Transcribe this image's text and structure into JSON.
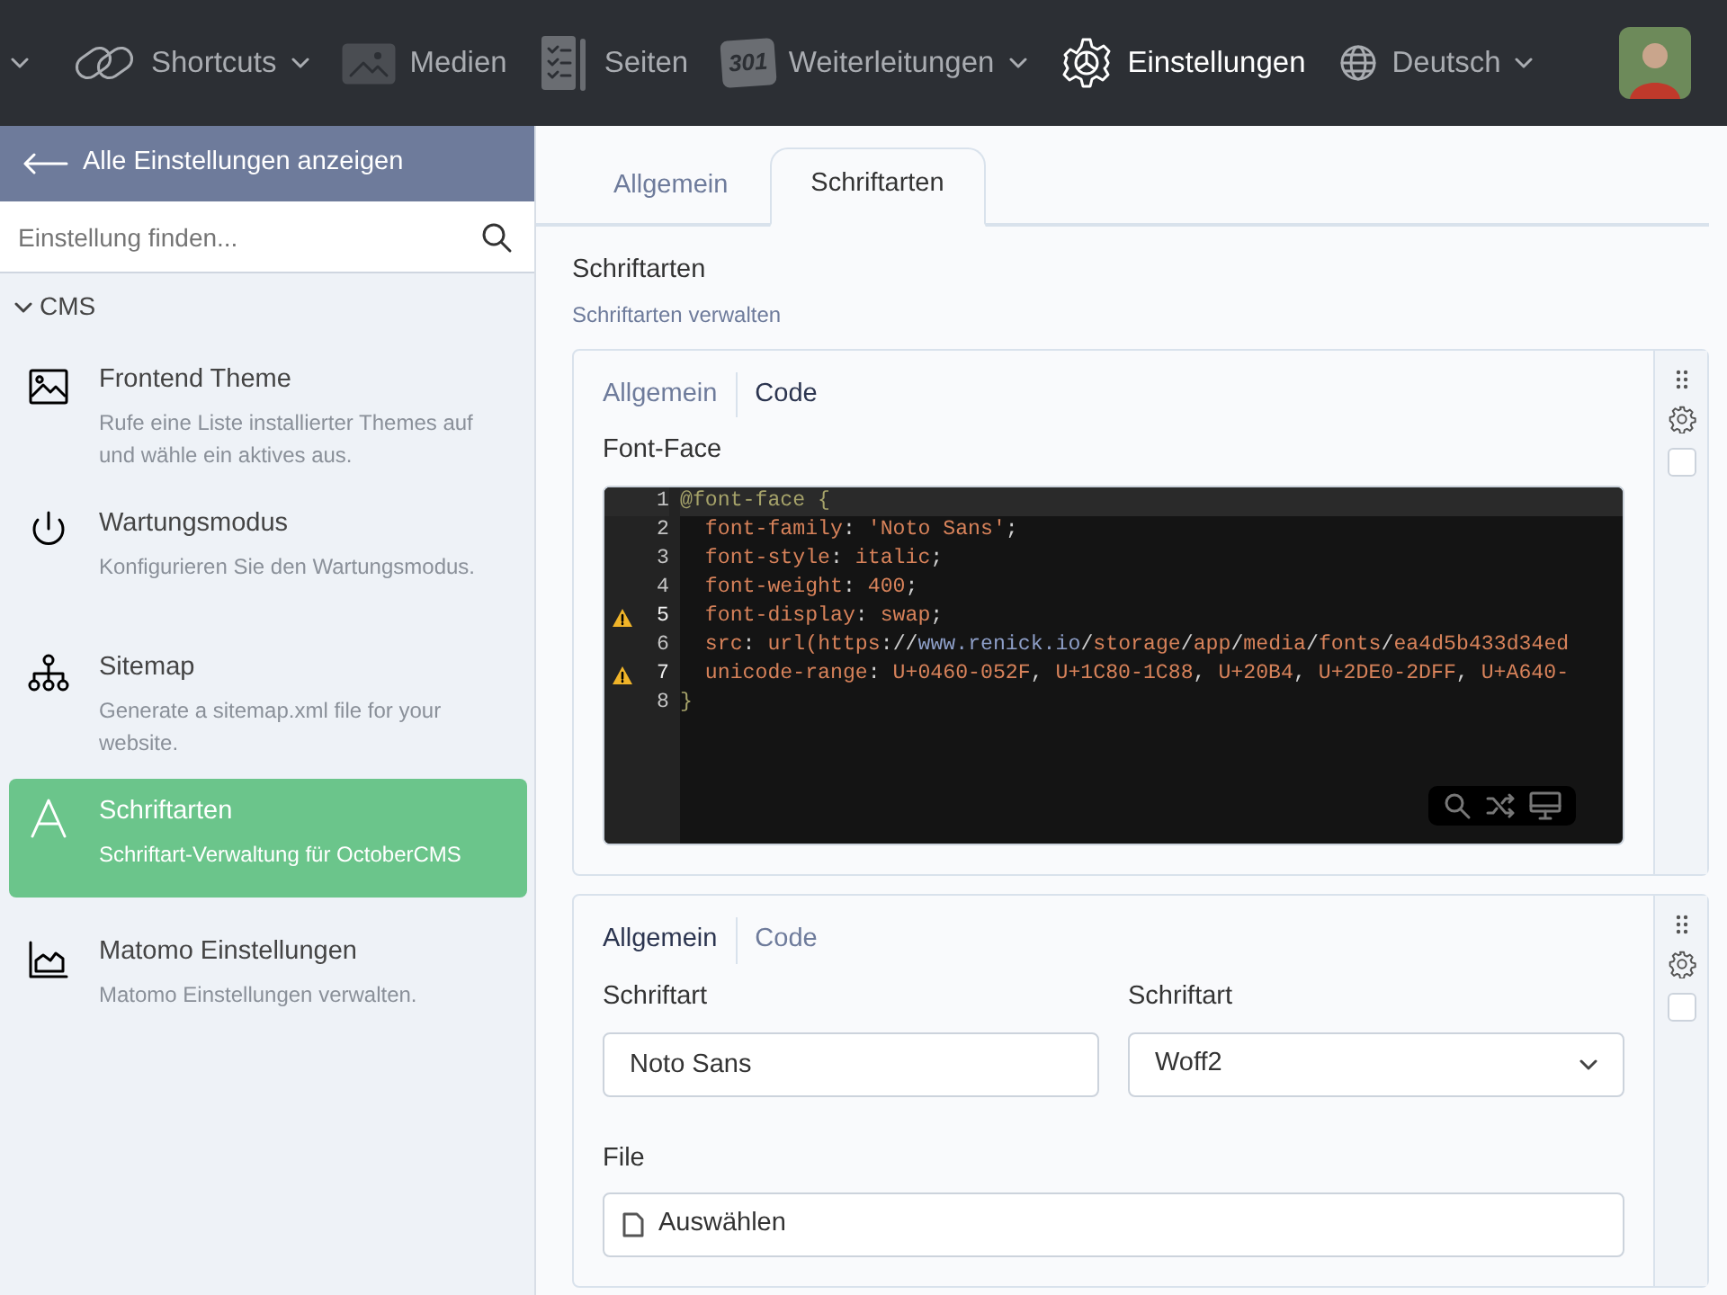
{
  "topnav": {
    "items": [
      {
        "kind": "cutoff",
        "dropdown": true,
        "active": false
      },
      {
        "kind": "link",
        "label": "Shortcuts",
        "dropdown": true,
        "active": false
      },
      {
        "kind": "image",
        "label": "Medien",
        "dropdown": false,
        "active": false
      },
      {
        "kind": "pages",
        "label": "Seiten",
        "dropdown": false,
        "active": false
      },
      {
        "kind": "redirect",
        "badge": "301",
        "label": "Weiterleitungen",
        "dropdown": true,
        "active": false
      },
      {
        "kind": "gear",
        "label": "Einstellungen",
        "dropdown": false,
        "active": true
      },
      {
        "kind": "globe",
        "label": "Deutsch",
        "dropdown": true,
        "active": false
      }
    ]
  },
  "sidebar": {
    "back_link": "Alle Einstellungen anzeigen",
    "search": {
      "placeholder": "Einstellung finden..."
    },
    "group": {
      "label": "CMS",
      "expanded": true,
      "items": [
        {
          "kind": "image",
          "title": "Frontend Theme",
          "description": "Rufe eine Liste installierter Themes auf und wähle ein aktives aus.",
          "selected": false
        },
        {
          "kind": "power",
          "title": "Wartungsmodus",
          "description": "Konfigurieren Sie den Wartungsmodus.",
          "selected": false
        },
        {
          "kind": "sitemap",
          "title": "Sitemap",
          "description": "Generate a sitemap.xml file for your website.",
          "selected": false
        },
        {
          "kind": "font",
          "title": "Schriftarten",
          "description": "Schriftart-Verwaltung für OctoberCMS",
          "selected": true
        },
        {
          "kind": "chart",
          "title": "Matomo Einstellungen",
          "description": "Matomo Einstellungen verwalten.",
          "selected": false
        }
      ]
    }
  },
  "main": {
    "tabs": [
      {
        "label": "Allgemein",
        "selected": false
      },
      {
        "label": "Schriftarten",
        "selected": true
      }
    ],
    "section": {
      "title": "Schriftarten",
      "subtitle": "Schriftarten verwalten"
    },
    "repeater_items": [
      {
        "kind": "code",
        "checked": false,
        "tabs": [
          {
            "label": "Allgemein",
            "selected": false
          },
          {
            "label": "Code",
            "selected": true
          }
        ],
        "field_label": "Font-Face",
        "lines": [
          {
            "number": "1",
            "warning": false,
            "active": true,
            "tokens": [
              {
                "kind": "at",
                "text": "@font-face {"
              }
            ]
          },
          {
            "number": "2",
            "warning": false,
            "active": false,
            "tokens": [
              {
                "kind": "prop",
                "text": "  font-family"
              },
              {
                "kind": "punct",
                "text": ": "
              },
              {
                "kind": "str",
                "text": "'Noto Sans'"
              },
              {
                "kind": "punct",
                "text": ";"
              }
            ]
          },
          {
            "number": "3",
            "warning": false,
            "active": false,
            "tokens": [
              {
                "kind": "prop",
                "text": "  font-style"
              },
              {
                "kind": "punct",
                "text": ": "
              },
              {
                "kind": "str",
                "text": "italic"
              },
              {
                "kind": "punct",
                "text": ";"
              }
            ]
          },
          {
            "number": "4",
            "warning": false,
            "active": false,
            "tokens": [
              {
                "kind": "prop",
                "text": "  font-weight"
              },
              {
                "kind": "punct",
                "text": ": "
              },
              {
                "kind": "str",
                "text": "400"
              },
              {
                "kind": "punct",
                "text": ";"
              }
            ]
          },
          {
            "number": "5",
            "warning": true,
            "active": false,
            "tokens": [
              {
                "kind": "prop",
                "text": "  font-display"
              },
              {
                "kind": "punct",
                "text": ": "
              },
              {
                "kind": "str",
                "text": "swap"
              },
              {
                "kind": "punct",
                "text": ";"
              }
            ]
          },
          {
            "number": "6",
            "warning": false,
            "active": false,
            "tokens": [
              {
                "kind": "prop",
                "text": "  src"
              },
              {
                "kind": "punct",
                "text": ": "
              },
              {
                "kind": "str",
                "text": "url("
              },
              {
                "kind": "str",
                "text": "https"
              },
              {
                "kind": "punct",
                "text": "://"
              },
              {
                "kind": "host",
                "text": "www.renick.io"
              },
              {
                "kind": "punct",
                "text": "/"
              },
              {
                "kind": "str",
                "text": "storage"
              },
              {
                "kind": "punct",
                "text": "/"
              },
              {
                "kind": "str",
                "text": "app"
              },
              {
                "kind": "punct",
                "text": "/"
              },
              {
                "kind": "str",
                "text": "media"
              },
              {
                "kind": "punct",
                "text": "/"
              },
              {
                "kind": "str",
                "text": "fonts"
              },
              {
                "kind": "punct",
                "text": "/"
              },
              {
                "kind": "str",
                "text": "ea4d5b433d34ed"
              }
            ]
          },
          {
            "number": "7",
            "warning": true,
            "active": false,
            "tokens": [
              {
                "kind": "prop",
                "text": "  unicode-range"
              },
              {
                "kind": "punct",
                "text": ": "
              },
              {
                "kind": "str",
                "text": "U+0460-052F"
              },
              {
                "kind": "punct",
                "text": ", "
              },
              {
                "kind": "str",
                "text": "U+1C80-1C88"
              },
              {
                "kind": "punct",
                "text": ", "
              },
              {
                "kind": "str",
                "text": "U+20B4"
              },
              {
                "kind": "punct",
                "text": ", "
              },
              {
                "kind": "str",
                "text": "U+2DE0-2DFF"
              },
              {
                "kind": "punct",
                "text": ", "
              },
              {
                "kind": "str",
                "text": "U+A640-"
              }
            ]
          },
          {
            "number": "8",
            "warning": false,
            "active": false,
            "tokens": [
              {
                "kind": "at",
                "text": "}"
              }
            ]
          }
        ]
      },
      {
        "kind": "form",
        "checked": false,
        "tabs": [
          {
            "label": "Allgemein",
            "selected": true
          },
          {
            "label": "Code",
            "selected": false
          }
        ],
        "fields": [
          {
            "kind": "text",
            "label": "Schriftart",
            "value": "Noto Sans"
          },
          {
            "kind": "select",
            "label": "Schriftart",
            "value": "Woff2"
          },
          {
            "kind": "file",
            "label": "File",
            "value": "Auswählen"
          }
        ]
      }
    ]
  }
}
